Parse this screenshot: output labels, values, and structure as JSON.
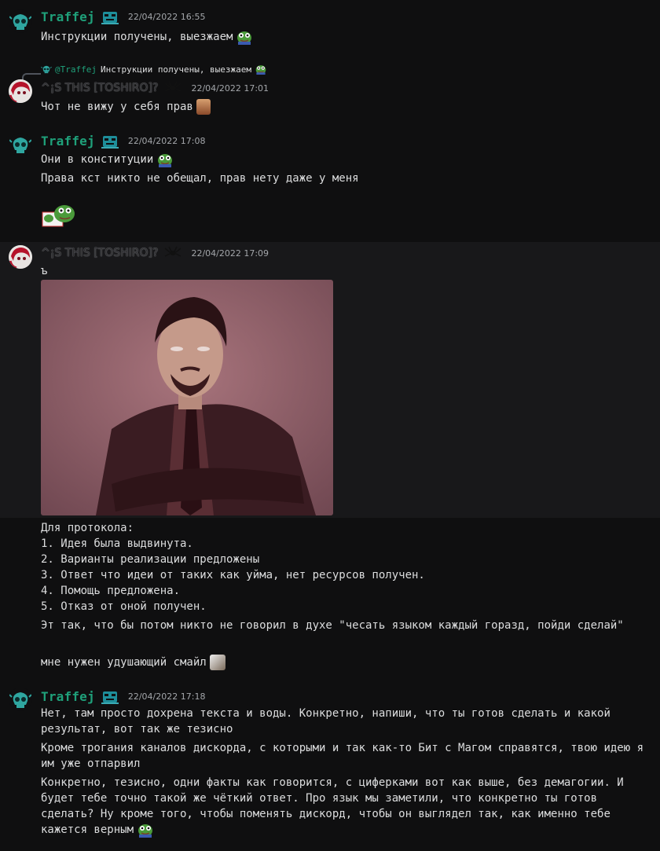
{
  "messages": [
    {
      "author": "Traffej",
      "timestamp": "22/04/2022 16:55",
      "lines": [
        "Инструкции получены, выезжаем"
      ]
    },
    {
      "reply_to": {
        "mention": "@Traffej",
        "text": "Инструкции получены, выезжаем"
      },
      "author": "^¡S THIS [TOSHIRO]?",
      "timestamp": "22/04/2022 17:01",
      "lines": [
        "Чот не вижу у себя прав"
      ]
    },
    {
      "author": "Traffej",
      "timestamp": "22/04/2022 17:08",
      "lines": [
        "Они в конституции",
        "Права кст никто не обещал, прав нету даже у меня"
      ]
    },
    {
      "author": "^¡S THIS [TOSHIRO]?",
      "timestamp": "22/04/2022 17:09",
      "lines": [
        "ъ"
      ],
      "image_alt": "man rolling eyes meme",
      "protocol_lines": [
        "Для протокола:",
        "1.  Идея была выдвинута.",
        "2. Варианты реализации предложены",
        "3. Ответ что идеи от таких как уйма, нет ресурсов получен.",
        "4. Помощь предложена.",
        "5. Отказ от оной получен."
      ],
      "followups": [
        "Эт так, что бы потом никто не говорил в духе \"чесать языком каждый горазд, пойди сделай\"",
        "мне нужен удушающий смайл"
      ]
    },
    {
      "author": "Traffej",
      "timestamp": "22/04/2022 17:18",
      "paragraphs": [
        "Нет, там просто дохрена текста и воды. Конкретно, напиши, что ты готов сделать и какой результат, вот так же тезисно",
        "Кроме трогания каналов дискорда, с которыми и так как-то Бит с Магом справятся, твою идею я им уже отпарвил",
        "Конкретно, тезисно, одни факты как говорится, с циферками вот как выше, без демагогии. И будет тебе точно такой же чёткий ответ. Про язык мы заметили, что конкретно ты готов сделать? Ну кроме того, чтобы поменять дискорд, чтобы он выглядел так, как именно тебе кажется верным"
      ]
    }
  ],
  "colors": {
    "traffej_name": "#1fa07a",
    "background": "#0f0f10",
    "hover_background": "#18181a",
    "text": "#dcddde",
    "timestamp": "#a3a6aa"
  },
  "icons": [
    "skull-avatar-icon",
    "anime-avatar-icon",
    "robot-badge-icon",
    "spider-badge-icon",
    "pepe-emoji-icon",
    "face-emoji-icon",
    "hands-emoji-icon"
  ]
}
